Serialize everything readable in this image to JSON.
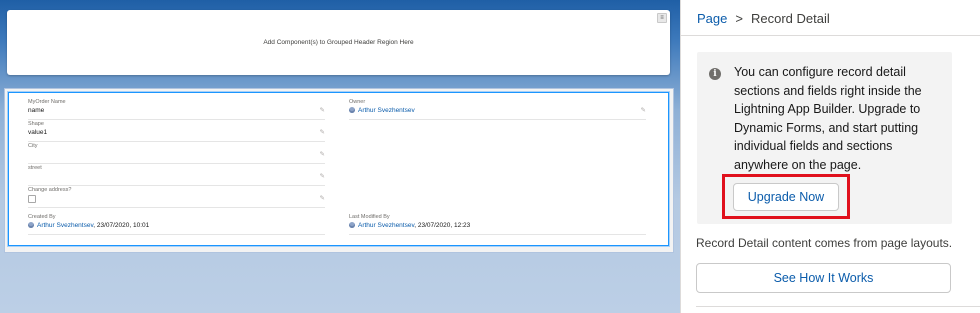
{
  "canvas": {
    "header_region": {
      "placeholder": "Add Component(s) to Grouped Header Region Here",
      "menu_glyph": "≡"
    },
    "record_detail": {
      "left_fields": [
        {
          "label": "MyOrder Name",
          "value": "name"
        },
        {
          "label": "Shape",
          "value": "value1"
        },
        {
          "label": "City",
          "value": ""
        },
        {
          "label": "street",
          "value": ""
        },
        {
          "label": "Change address?",
          "value": ""
        },
        {
          "label": "Created By",
          "user": "Arthur Svezhentsev",
          "value": ", 23/07/2020, 10:01"
        }
      ],
      "right_fields": [
        {
          "label": "Owner",
          "user": "Arthur Svezhentsev"
        },
        {
          "label": "Last Modified By",
          "user": "Arthur Svezhentsev",
          "value": ", 23/07/2020, 12:23"
        }
      ]
    }
  },
  "panel": {
    "breadcrumb": {
      "link": "Page",
      "separator": ">",
      "current": "Record Detail"
    },
    "info": {
      "icon": "info-icon",
      "text": "You can configure record detail sections and fields right inside the Lightning App Builder. Upgrade to Dynamic Forms, and start putting individual fields and sections anywhere on the page."
    },
    "upgrade_label": "Upgrade Now",
    "layout_note": "Record Detail content comes from page layouts.",
    "see_how_label": "See How It Works"
  },
  "colors": {
    "link": "#0b5cab",
    "highlight": "#e0101c",
    "selection": "#1b96ff",
    "canvas_top": "#1f5fa6"
  }
}
